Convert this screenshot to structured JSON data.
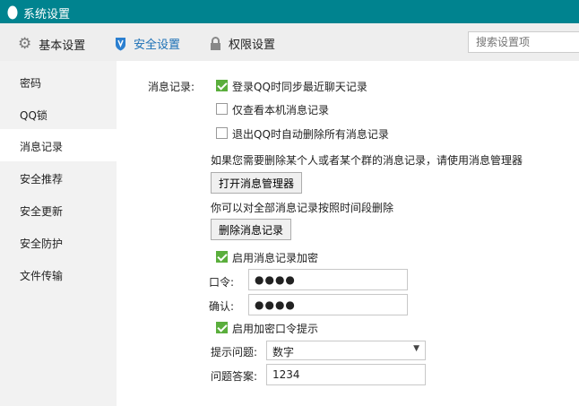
{
  "window": {
    "title": "系统设置"
  },
  "toolbar": {
    "tabs": [
      {
        "label": "基本设置"
      },
      {
        "label": "安全设置"
      },
      {
        "label": "权限设置"
      }
    ],
    "search_placeholder": "搜索设置项",
    "active_color": "#1a6fb5"
  },
  "sidebar": {
    "items": [
      {
        "label": "密码"
      },
      {
        "label": "QQ锁"
      },
      {
        "label": "消息记录"
      },
      {
        "label": "安全推荐"
      },
      {
        "label": "安全更新"
      },
      {
        "label": "安全防护"
      },
      {
        "label": "文件传输"
      }
    ],
    "selected": "消息记录"
  },
  "content": {
    "section_label": "消息记录:",
    "options": [
      {
        "label": "登录QQ时同步最近聊天记录",
        "checked": true
      },
      {
        "label": "仅查看本机消息记录",
        "checked": false
      },
      {
        "label": "退出QQ时自动删除所有消息记录",
        "checked": false
      }
    ],
    "manager_hint": "如果您需要删除某个人或者某个群的消息记录，请使用消息管理器",
    "open_manager_button": "打开消息管理器",
    "delete_hint": "你可以对全部消息记录按照时间段删除",
    "delete_button": "删除消息记录",
    "encrypt": {
      "label": "启用消息记录加密",
      "checked": true
    },
    "password": {
      "label": "口令:",
      "value": "●●●●"
    },
    "confirm": {
      "label": "确认:",
      "value": "●●●●"
    },
    "hint_enable": {
      "label": "启用加密口令提示",
      "checked": true
    },
    "question": {
      "label": "提示问题:",
      "value": "数字"
    },
    "answer": {
      "label": "问题答案:",
      "value": "1234"
    }
  }
}
